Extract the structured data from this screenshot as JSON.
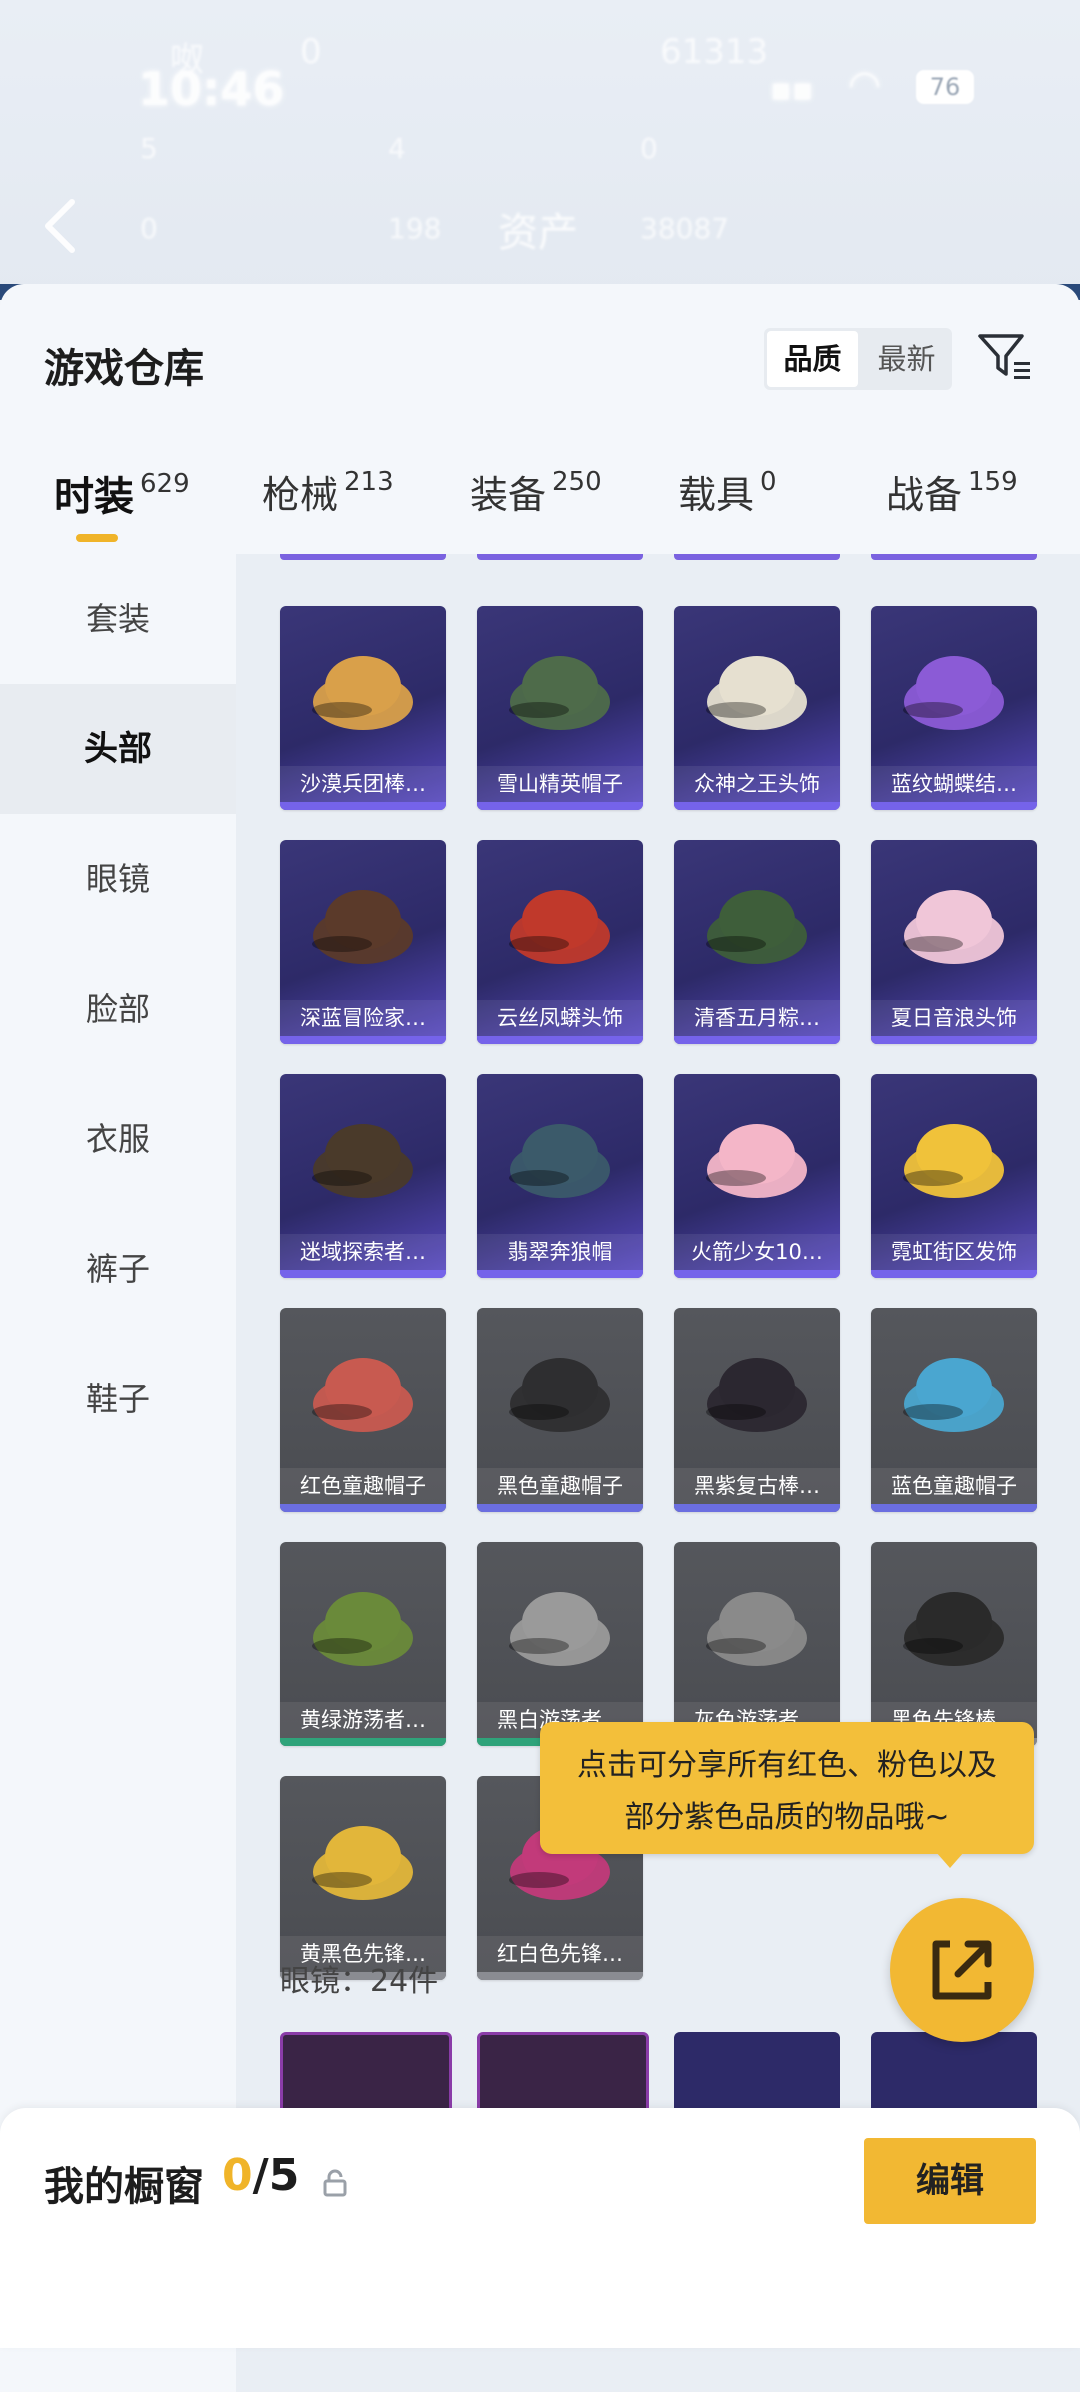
{
  "status_bar": {
    "time": "10:46",
    "battery": "76"
  },
  "header": {
    "title": "资产",
    "faint_top": [
      "呶",
      "0",
      "61313"
    ],
    "faint_mid": [
      "5",
      "4",
      "0"
    ],
    "faint_low": [
      "0",
      "198",
      "38087"
    ]
  },
  "sheet": {
    "title": "游戏仓库",
    "sort": [
      "品质",
      "最新"
    ],
    "sort_selected": "品质"
  },
  "tabs": [
    {
      "label": "时装",
      "count": "629"
    },
    {
      "label": "枪械",
      "count": "213"
    },
    {
      "label": "装备",
      "count": "250"
    },
    {
      "label": "载具",
      "count": "0"
    },
    {
      "label": "战备",
      "count": "159"
    }
  ],
  "sidebar": [
    "套装",
    "头部",
    "眼镜",
    "脸部",
    "衣服",
    "裤子",
    "鞋子"
  ],
  "items": [
    {
      "name": "沙漠兵团棒…",
      "rarity": "purple"
    },
    {
      "name": "雪山精英帽子",
      "rarity": "purple"
    },
    {
      "name": "众神之王头饰",
      "rarity": "purple"
    },
    {
      "name": "蓝纹蝴蝶结…",
      "rarity": "purple"
    },
    {
      "name": "深蓝冒险家…",
      "rarity": "purple"
    },
    {
      "name": "云丝凤蟒头饰",
      "rarity": "purple"
    },
    {
      "name": "清香五月粽…",
      "rarity": "purple"
    },
    {
      "name": "夏日音浪头饰",
      "rarity": "purple"
    },
    {
      "name": "迷域探索者…",
      "rarity": "purple"
    },
    {
      "name": "翡翠奔狼帽",
      "rarity": "purple"
    },
    {
      "name": "火箭少女10…",
      "rarity": "purple"
    },
    {
      "name": "霓虹街区发饰",
      "rarity": "purple"
    },
    {
      "name": "红色童趣帽子",
      "rarity": "blue"
    },
    {
      "name": "黑色童趣帽子",
      "rarity": "blue"
    },
    {
      "name": "黑紫复古棒…",
      "rarity": "blue"
    },
    {
      "name": "蓝色童趣帽子",
      "rarity": "blue"
    },
    {
      "name": "黄绿游荡者…",
      "rarity": "green"
    },
    {
      "name": "黑白游荡者…",
      "rarity": "green"
    },
    {
      "name": "灰色游荡者…",
      "rarity": "grey"
    },
    {
      "name": "黑色先锋棒…",
      "rarity": "grey"
    },
    {
      "name": "黄黑色先锋…",
      "rarity": "grey"
    },
    {
      "name": "红白色先锋…",
      "rarity": "grey"
    }
  ],
  "section_label": "眼镜：24件",
  "tooltip": [
    "点击可分享所有红色、粉色以及",
    "部分紫色品质的物品哦~"
  ],
  "bottom": {
    "label": "我的橱窗",
    "count_current": "0",
    "count_total": "/5",
    "edit_label": "编辑"
  },
  "colors": {
    "accent": "#f2b833",
    "purple_card": "#3a3678",
    "grey_card": "#4a4c51"
  },
  "icons": [
    "back-icon",
    "filter-icon",
    "share-icon",
    "lock-icon"
  ]
}
